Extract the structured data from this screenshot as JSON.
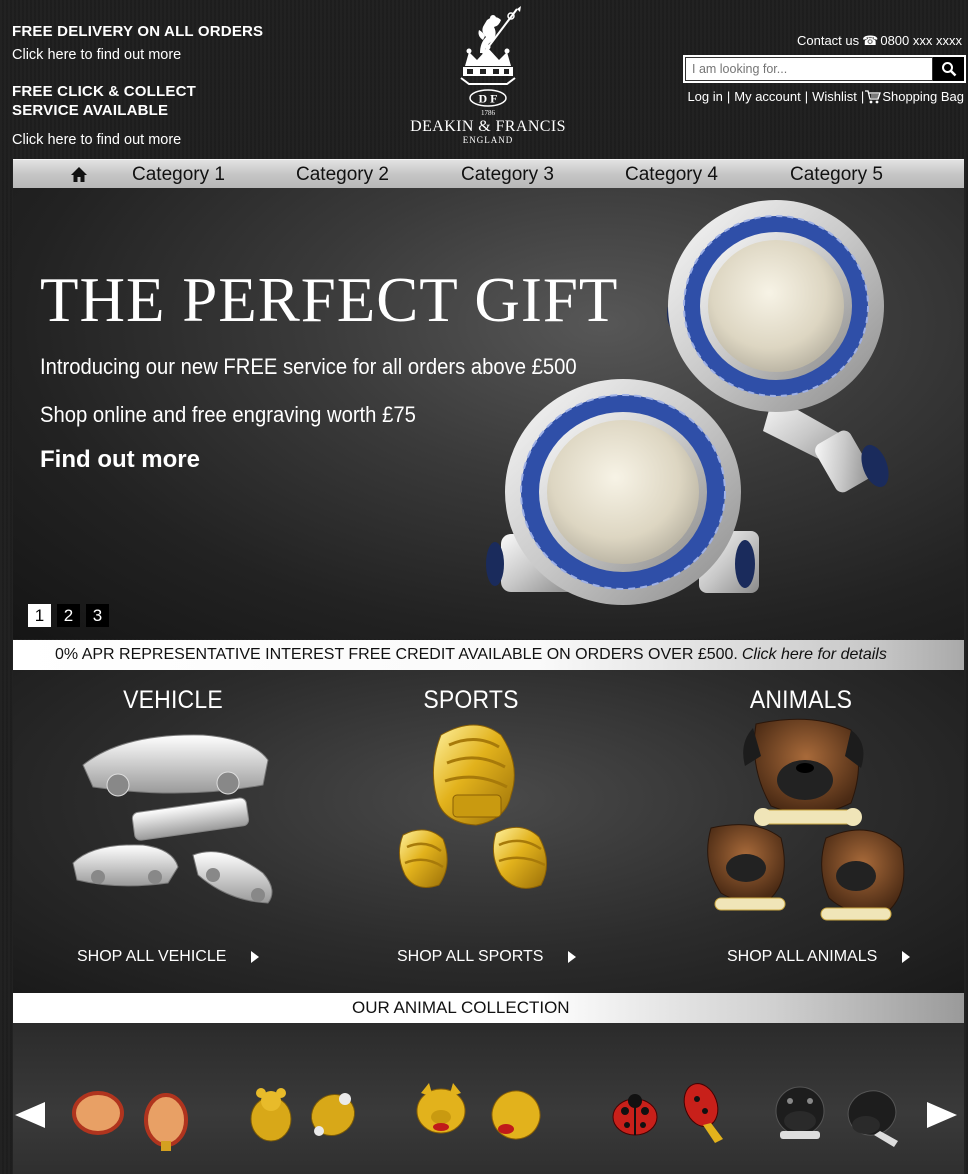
{
  "promos": {
    "delivery_title": "FREE DELIVERY ON ALL ORDERS",
    "delivery_link": "Click here to find out more",
    "collect_title": "FREE CLICK & COLLECT SERVICE AVAILABLE",
    "collect_link": "Click here to find out more"
  },
  "logo": {
    "year": "1786",
    "brand": "DEAKIN & FRANCIS",
    "country": "ENGLAND",
    "monogram": "D F"
  },
  "header": {
    "contact_label": "Contact us",
    "phone": "0800 xxx xxxx",
    "search_placeholder": "I am looking for...",
    "login": "Log in",
    "account": "My account",
    "wishlist": "Wishlist",
    "bag": "Shopping Bag"
  },
  "nav": {
    "items": [
      "Category 1",
      "Category 2",
      "Category 3",
      "Category 4",
      "Category 5"
    ]
  },
  "hero": {
    "title": "THE PERFECT GIFT",
    "line1": "Introducing our new FREE service for all orders above £500",
    "line2": "Shop online and free engraving worth £75",
    "cta": "Find out more",
    "pages": [
      "1",
      "2",
      "3"
    ],
    "active_page": 1
  },
  "credit": {
    "text": "0% APR REPRESENTATIVE INTEREST FREE CREDIT AVAILABLE ON ORDERS OVER £500.",
    "link": "Click here for details"
  },
  "categories": [
    {
      "title": "VEHICLE",
      "shop": "SHOP ALL VEHICLE"
    },
    {
      "title": "SPORTS",
      "shop": "SHOP ALL SPORTS"
    },
    {
      "title": "ANIMALS",
      "shop": "SHOP ALL ANIMALS"
    }
  ],
  "collection": {
    "title": "OUR ANIMAL COLLECTION",
    "items": [
      "oval-cufflinks",
      "bee-cufflinks",
      "pig-cufflinks",
      "ladybird-cufflinks",
      "hippo-cufflinks"
    ]
  },
  "icons": {
    "home": "home-icon",
    "search": "search-icon",
    "phone": "phone-icon",
    "cart": "cart-icon",
    "prev": "left-arrow-icon",
    "next": "right-arrow-icon"
  },
  "colors": {
    "background": "#1e1e1e",
    "nav": "#c6c6c6",
    "text": "#ffffff",
    "sapphire": "#2f4fa8",
    "gold": "#e2b21c"
  }
}
